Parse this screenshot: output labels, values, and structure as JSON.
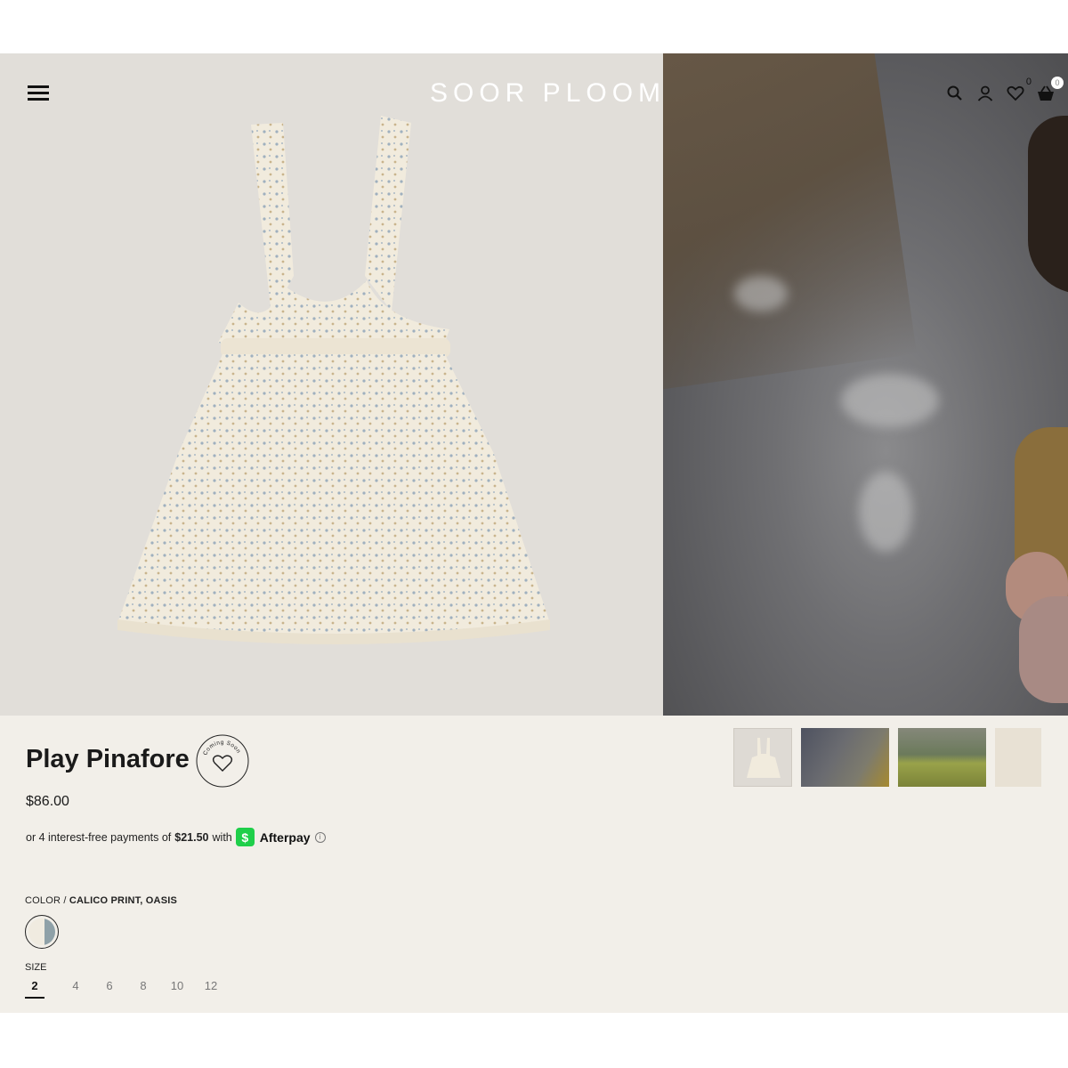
{
  "header": {
    "logo": "SOOR PLOOM",
    "wishlist_count": "0",
    "bag_count": "0",
    "icons": [
      "menu-icon",
      "search-icon",
      "user-icon",
      "heart-icon",
      "basket-icon"
    ]
  },
  "product": {
    "title": "Play Pinafore",
    "coming_soon_label": "Coming Soon",
    "price": "$86.00",
    "afterpay": {
      "prefix": "or 4 interest-free payments of",
      "amount": "$21.50",
      "with": "with",
      "brand": "Afterpay",
      "badge": "$"
    },
    "color": {
      "label": "COLOR / ",
      "value": "CALICO PRINT, OASIS"
    },
    "size": {
      "label": "SIZE",
      "options": [
        "2",
        "4",
        "6",
        "8",
        "10",
        "12"
      ],
      "selected": "2"
    }
  },
  "colors": {
    "page_bg": "#f2efe9",
    "hero_bg": "#e1ded9",
    "afterpay_green": "#1fcf4a",
    "text": "#1a1a1a"
  }
}
